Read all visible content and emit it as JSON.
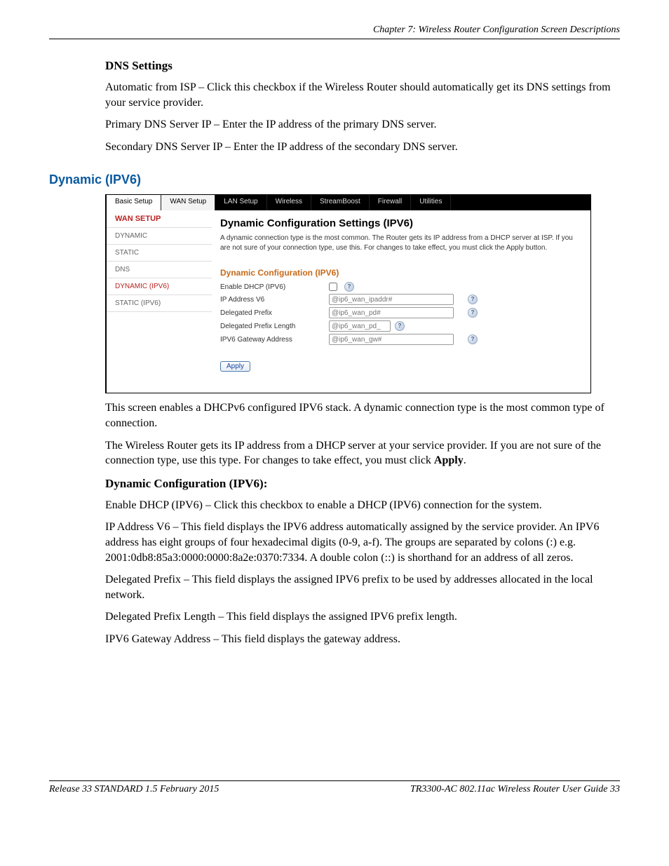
{
  "header": {
    "chapter": "Chapter 7: Wireless Router Configuration Screen Descriptions"
  },
  "dns": {
    "heading": "DNS Settings",
    "auto": "Automatic from ISP – Click this checkbox if the Wireless Router should automatically get its DNS settings from your service provider.",
    "primary": "Primary DNS Server IP – Enter the IP address of the primary DNS server.",
    "secondary": "Secondary DNS Server IP – Enter the IP address of the secondary DNS server."
  },
  "section": {
    "title": "Dynamic (IPV6)"
  },
  "router": {
    "tabs": {
      "basic": "Basic Setup",
      "wan": "WAN Setup",
      "lan": "LAN Setup",
      "wireless": "Wireless",
      "streamboost": "StreamBoost",
      "firewall": "Firewall",
      "utilities": "Utilities"
    },
    "sidebar": {
      "title": "WAN SETUP",
      "dynamic": "DYNAMIC",
      "static": "STATIC",
      "dns": "DNS",
      "dynipv6": "DYNAMIC (IPV6)",
      "statipv6": "STATIC (IPV6)"
    },
    "main": {
      "title": "Dynamic Configuration Settings (IPV6)",
      "desc": "A dynamic connection type is the most common. The Router gets its IP address from a DHCP server at ISP. If you are not sure of your connection type, use this. For changes to take effect, you must click the Apply button.",
      "subtitle": "Dynamic Configuration (IPV6)",
      "rows": {
        "enable": "Enable DHCP (IPV6)",
        "ipv6": "IP Address V6",
        "dprefix": "Delegated Prefix",
        "dprefixlen": "Delegated Prefix Length",
        "gateway": "IPV6 Gateway Address"
      },
      "placeholders": {
        "ipv6": "@ip6_wan_ipaddr#",
        "dprefix": "@ip6_wan_pd#",
        "dprefixlen": "@ip6_wan_pd_",
        "gateway": "@ip6_wan_gw#"
      },
      "apply": "Apply",
      "help": "?"
    }
  },
  "body": {
    "p1": "This screen enables a DHCPv6 configured IPV6 stack. A dynamic connection type is the most common type of connection.",
    "p2a": "The Wireless Router gets its IP address from a DHCP server at your service provider. If you are not sure of the connection type, use this type. For changes to take effect, you must click ",
    "p2b": "Apply",
    "p2c": ".",
    "h2": "Dynamic Configuration (IPV6):",
    "p3": "Enable DHCP (IPV6) – Click this checkbox to enable a DHCP (IPV6) connection for the system.",
    "p4": "IP Address V6 – This field displays the IPV6 address automatically assigned by the service provider. An IPV6 address has eight groups of four hexadecimal digits (0-9, a-f). The groups are separated by colons (:) e.g. 2001:0db8:85a3:0000:0000:8a2e:0370:7334. A double colon (::) is shorthand for an address of all zeros.",
    "p5": "Delegated Prefix – This field displays the assigned IPV6 prefix to be used by addresses allocated in the local network.",
    "p6": "Delegated Prefix Length – This field displays the assigned IPV6 prefix length.",
    "p7": "IPV6 Gateway Address – This field displays the gateway address."
  },
  "footer": {
    "left": "Release 33 STANDARD 1.5    February 2015",
    "right": "TR3300-AC 802.11ac Wireless Router User Guide   33"
  }
}
